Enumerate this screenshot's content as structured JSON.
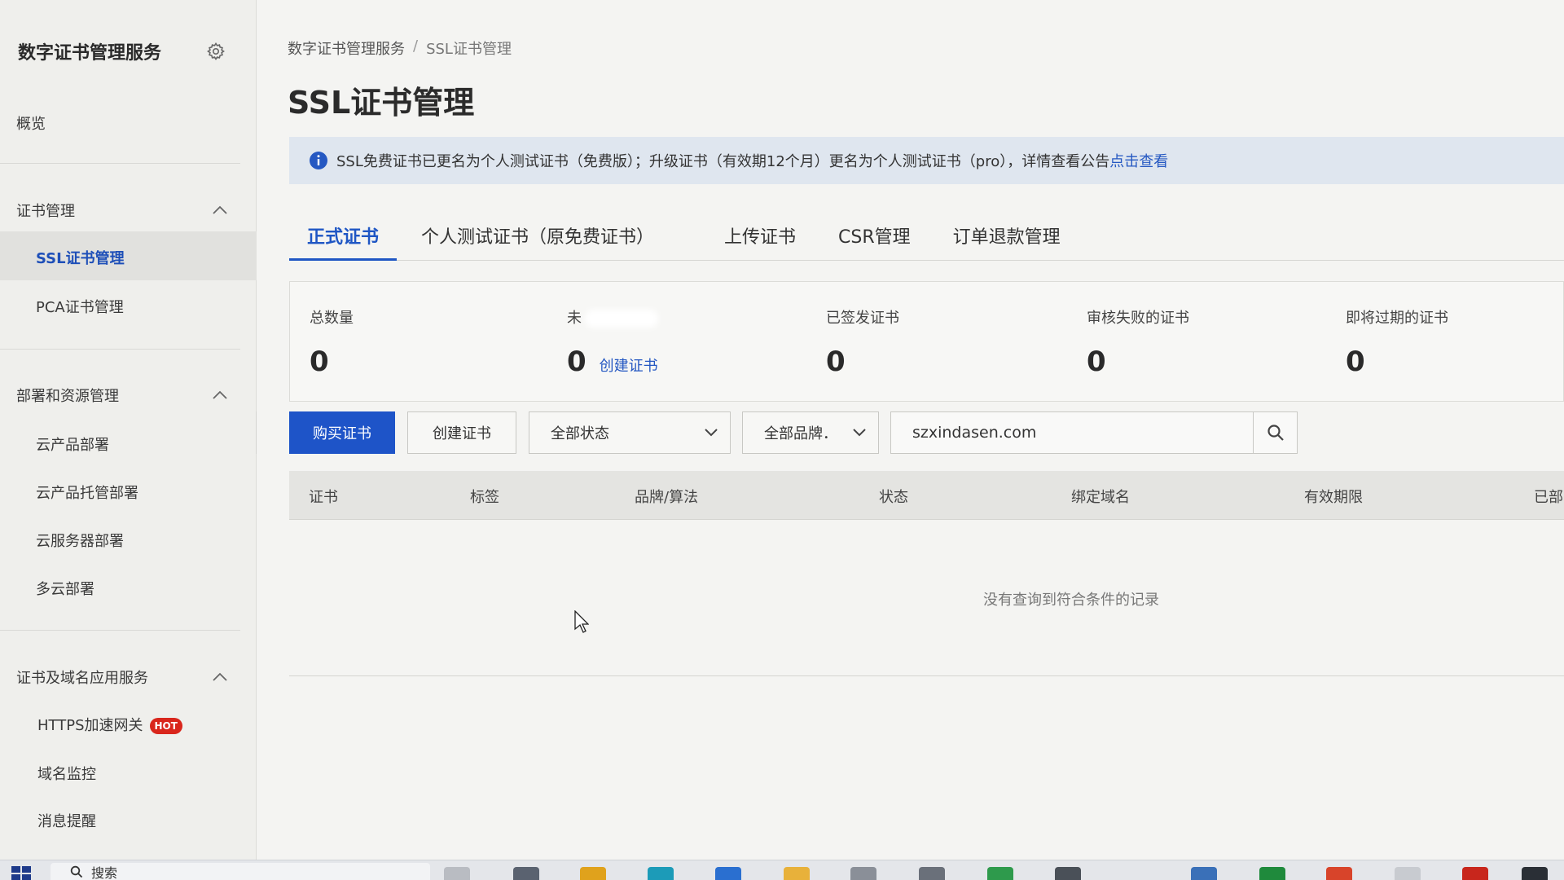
{
  "sidebar": {
    "title": "数字证书管理服务",
    "overview": "概览",
    "groups": [
      {
        "label": "证书管理",
        "items": [
          "SSL证书管理",
          "PCA证书管理"
        ]
      },
      {
        "label": "部署和资源管理",
        "items": [
          "云产品部署",
          "云产品托管部署",
          "云服务器部署",
          "多云部署"
        ]
      },
      {
        "label": "证书及域名应用服务",
        "items": [
          "HTTPS加速网关",
          "域名监控",
          "消息提醒"
        ]
      }
    ],
    "hot_badge": "HOT"
  },
  "breadcrumb": {
    "root": "数字证书管理服务",
    "separator": "/",
    "current": "SSL证书管理"
  },
  "page_title": "SSL证书管理",
  "notice": {
    "text": "SSL免费证书已更名为个人测试证书（免费版）；升级证书（有效期12个月）更名为个人测试证书（pro），详情查看公告",
    "link": "点击查看"
  },
  "tabs": [
    "正式证书",
    "个人测试证书（原免费证书）",
    "上传证书",
    "CSR管理",
    "订单退款管理"
  ],
  "stats": {
    "total": {
      "label": "总数量",
      "value": "0"
    },
    "unused": {
      "label": "未",
      "value": "0",
      "link": "创建证书"
    },
    "issued": {
      "label": "已签发证书",
      "value": "0"
    },
    "failed": {
      "label": "审核失败的证书",
      "value": "0"
    },
    "expiring": {
      "label": "即将过期的证书",
      "value": "0"
    }
  },
  "toolbar": {
    "buy": "购买证书",
    "create": "创建证书",
    "status_select": "全部状态",
    "brand_select": "全部品牌．",
    "search_value": "szxindasen.com"
  },
  "table": {
    "columns": [
      "证书",
      "标签",
      "品牌/算法",
      "状态",
      "绑定域名",
      "有效期限",
      "已部"
    ],
    "empty": "没有查询到符合条件的记录"
  },
  "taskbar": {
    "search": "搜索"
  },
  "colors": {
    "primary": "#1e54c8",
    "hot": "#d9261c",
    "notice_bg": "#dfe6ef"
  }
}
